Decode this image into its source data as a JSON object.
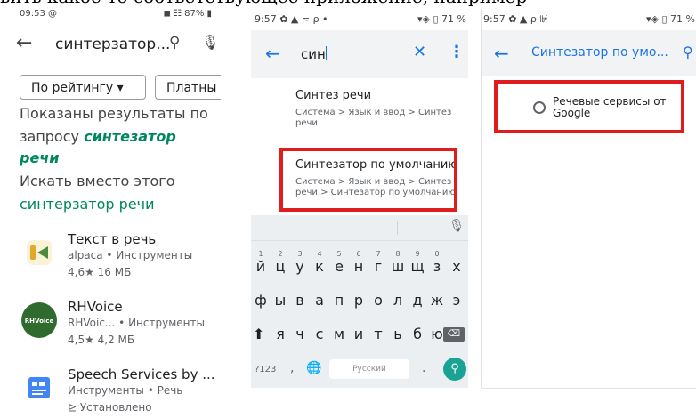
{
  "caption_top": "вить какое-то соответствующее приложение, например",
  "panel1": {
    "status_time": "09:53 @",
    "status_right": "◼ ☷ 87% ▮",
    "search_query": "синтерзатор...",
    "chips": [
      "По рейтингу ▾",
      "Платны"
    ],
    "shown_results_line1": "Показаны результаты по",
    "shown_results_line2_prefix": "запросу ",
    "shown_results_keyword1": "синтезатор",
    "shown_results_keyword2": "речи",
    "instead_text": "Искать вместо этого",
    "instead_link": "синтерзатор речи",
    "apps": [
      {
        "name": "Текст в речь",
        "sub": "alpaca • Инструменты",
        "meta": "4,6★ 16 МБ"
      },
      {
        "name": "RHVoice",
        "sub": "RHVoic... • Инструменты",
        "meta": "4,5★ 4,2 МБ",
        "icon_text": "RHVoice"
      },
      {
        "name": "Speech Services by ...",
        "sub": "Инструменты • Речь",
        "meta": "⊵ Установлено"
      }
    ]
  },
  "panel2": {
    "status_time": "9:57 ✿ ▲ ≂ ρ •",
    "status_right": "▾◈ ▯ 71 %",
    "query": "син",
    "results": [
      {
        "title": "Синтез речи",
        "path": "Система > Язык и ввод > Синтез речи"
      },
      {
        "title": "Синтезатор по умолчанию",
        "path": "Система > Язык и ввод > Синтез речи > Синтезатор по умолчанию"
      }
    ],
    "keyboard": {
      "row1": [
        "й",
        "ц",
        "у",
        "к",
        "е",
        "н",
        "г",
        "ш",
        "щ",
        "з",
        "х"
      ],
      "row1_hints": [
        "1",
        "2",
        "3",
        "4",
        "5",
        "6",
        "7",
        "8",
        "9",
        "0",
        ""
      ],
      "row2": [
        "ф",
        "ы",
        "в",
        "а",
        "п",
        "р",
        "о",
        "л",
        "д",
        "ж",
        "э"
      ],
      "row3": [
        "я",
        "ч",
        "с",
        "м",
        "и",
        "т",
        "ь",
        "б",
        "ю"
      ],
      "k123": "?123",
      "comma": ",",
      "space_label": "Русский",
      "dot": "."
    }
  },
  "panel3": {
    "status_time": "9:57 ✿ ▲ ρ ⊯",
    "status_right": "▾◈ ▯ 71 %",
    "title": "Синтезатор по умо...",
    "option_line1": "Речевые сервисы от",
    "option_line2": "Google"
  },
  "colors": {
    "highlight": "#e01d1d",
    "accent": "#1a73e8",
    "play_green": "#01875f"
  },
  "icons": [
    "back-arrow-icon",
    "search-icon",
    "mic-icon",
    "close-icon",
    "more-vert-icon",
    "shift-icon",
    "backspace-icon",
    "globe-icon",
    "search-enter-icon",
    "radio-icon"
  ]
}
